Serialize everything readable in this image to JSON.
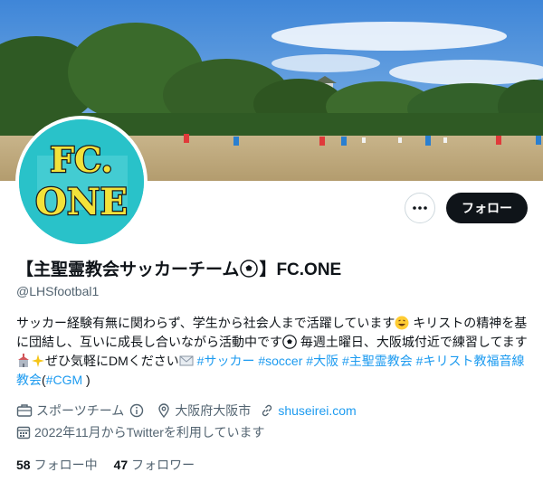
{
  "profile": {
    "name_part1": "【主聖霊教会サッカーチーム",
    "name_part2": "】FC.ONE",
    "handle": "@LHSfootbal1",
    "avatar_text_line1": "FC.",
    "avatar_text_line2": "ONE"
  },
  "actions": {
    "more_icon": "more-dots-icon",
    "follow_label": "フォロー"
  },
  "bio": {
    "t1": "サッカー経験有無に関わらず、学生から社会人まで活躍しています",
    "t2": " キリストの精神を基に団結し、互いに成長し合いながら活動中です",
    "t3": " 毎週土曜日、大阪城付近で練習してます",
    "t4": "ぜひ気軽にDMください",
    "tag1": "#サッカー",
    "tag2": "#soccer",
    "tag3": "#大阪",
    "tag4": "#主聖霊教会",
    "tag5": "#キリスト教福音線教会",
    "paren_open": "(",
    "tag6": "#CGM",
    "paren_close": " )"
  },
  "meta": {
    "category": "スポーツチーム",
    "location": "大阪府大阪市",
    "website": "shuseirei.com",
    "joined": "2022年11月からTwitterを利用しています"
  },
  "counts": {
    "following_num": "58",
    "following_label": "フォロー中",
    "followers_num": "47",
    "followers_label": "フォロワー"
  },
  "colors": {
    "accent": "#1d9bf0",
    "text": "#0f1419",
    "secondary": "#536471",
    "avatar_bg": "#29c2c9",
    "avatar_text": "#f3e23a"
  }
}
